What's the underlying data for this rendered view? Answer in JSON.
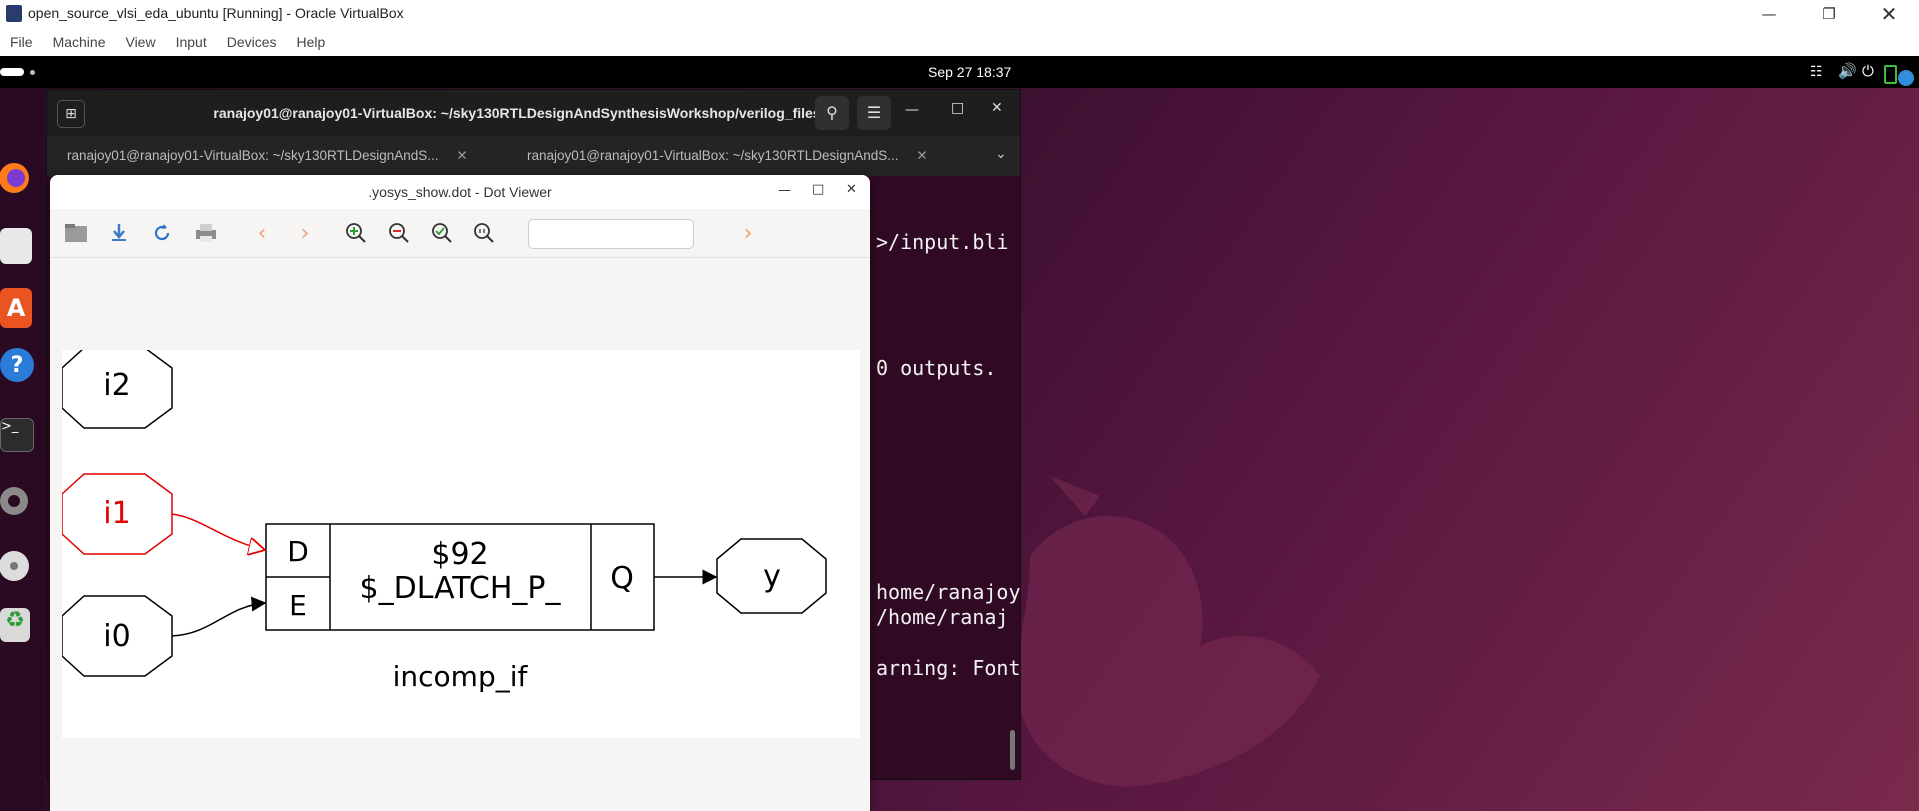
{
  "host": {
    "title": "open_source_vlsi_eda_ubuntu [Running] - Oracle VirtualBox",
    "menu": [
      "File",
      "Machine",
      "View",
      "Input",
      "Devices",
      "Help"
    ]
  },
  "guest": {
    "clock": "Sep 27  18:37",
    "terminal": {
      "title": "ranajoy01@ranajoy01-VirtualBox: ~/sky130RTLDesignAndSynthesisWorkshop/verilog_files",
      "tabs": [
        {
          "label": "ranajoy01@ranajoy01-VirtualBox: ~/sky130RTLDesignAndS..."
        },
        {
          "label": "ranajoy01@ranajoy01-VirtualBox: ~/sky130RTLDesignAndS..."
        }
      ],
      "lines": {
        "l1": ">/input.bli",
        "l2": "0 outputs.",
        "l3": "home/ranajoy",
        "l4": "/home/ranaj",
        "l5": "arning: Font"
      }
    },
    "dot_viewer": {
      "title": ".yosys_show.dot - Dot Viewer",
      "search_placeholder": "",
      "graph": {
        "nodes": {
          "i2": "i2",
          "i1": "i1",
          "i0": "i0",
          "y": "y"
        },
        "cell": {
          "id": "$92",
          "type": "$_DLATCH_P_",
          "port_d": "D",
          "port_e": "E",
          "port_q": "Q"
        },
        "module_name": "incomp_if",
        "highlight_color": "#e00000"
      }
    }
  }
}
